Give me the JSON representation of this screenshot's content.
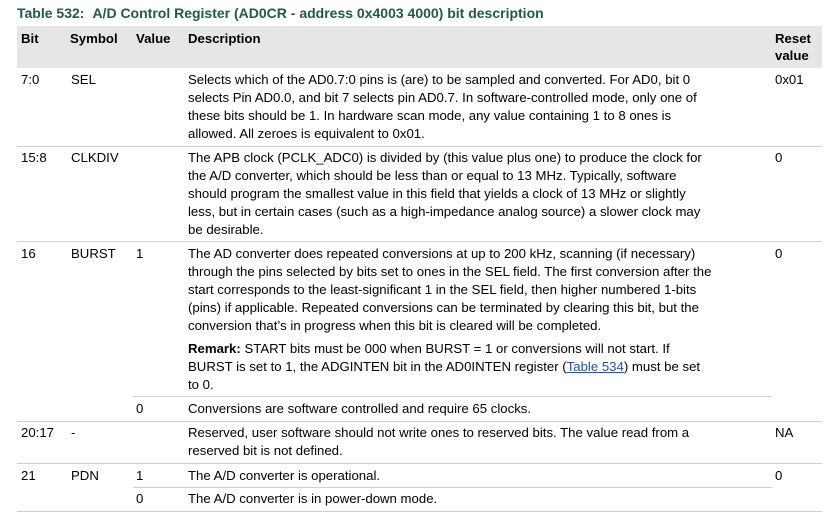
{
  "table": {
    "number": "Table 532:",
    "caption": "A/D Control Register (AD0CR - address 0x4003 4000) bit description",
    "headers": {
      "bit": "Bit",
      "symbol": "Symbol",
      "value": "Value",
      "description": "Description",
      "reset_line1": "Reset",
      "reset_line2": "value"
    },
    "rows": {
      "sel": {
        "bit": "7:0",
        "symbol": "SEL",
        "reset": "0x01",
        "desc": [
          "Selects which of the AD0.7:0 pins is (are) to be sampled and converted. For AD0, bit 0",
          "selects Pin AD0.0, and bit 7 selects pin AD0.7. In software-controlled mode, only one of",
          "these bits should be 1. In hardware scan mode, any value containing 1 to 8 ones is",
          "allowed. All zeroes is equivalent to 0x01."
        ]
      },
      "clkdiv": {
        "bit": "15:8",
        "symbol": "CLKDIV",
        "reset": "0",
        "desc": [
          "The APB clock (PCLK_ADC0) is divided by (this value plus one) to produce the clock for",
          "the A/D converter, which should be less than or equal to 13 MHz. Typically, software",
          "should program the smallest value in this field that yields a clock of 13 MHz or slightly",
          "less, but in certain cases (such as a high-impedance analog source) a slower clock may",
          "be desirable."
        ]
      },
      "burst": {
        "bit": "16",
        "symbol": "BURST",
        "value1": "1",
        "reset": "0",
        "desc": [
          "The AD converter does repeated conversions at up to 200 kHz, scanning (if necessary)",
          "through the pins selected by bits set to ones in the SEL field. The first conversion after the",
          "start corresponds to the least-significant 1 in the SEL field, then higher numbered 1-bits",
          "(pins) if applicable. Repeated conversions can be terminated by clearing this bit, but the",
          "conversion that’s in progress when this bit is cleared will be completed."
        ],
        "remark_label": "Remark:",
        "remark_line1": " START bits must be 000 when BURST = 1 or conversions will not start. If",
        "remark_line2": "BURST is set to 1, the ADGINTEN bit in the AD0INTEN register (",
        "remark_link": "Table 534",
        "remark_line2_end": ") must be set",
        "remark_line3": "to 0.",
        "value0": "0",
        "desc0": "Conversions are software controlled and require 65 clocks."
      },
      "reserved": {
        "bit": "20:17",
        "symbol": "-",
        "reset": "NA",
        "desc": [
          "Reserved, user software should not write ones to reserved bits. The value read from a",
          "reserved bit is not defined."
        ]
      },
      "pdn": {
        "bit": "21",
        "symbol": "PDN",
        "reset": "0",
        "value1": "1",
        "desc1": "The A/D converter is operational.",
        "value0": "0",
        "desc0": "The A/D converter is in power-down mode."
      }
    }
  },
  "colors": {
    "title": "#1f5a46",
    "header_bg": "#e6e6e6",
    "link": "#1d4fcc",
    "rule": "#cfcfcf"
  }
}
